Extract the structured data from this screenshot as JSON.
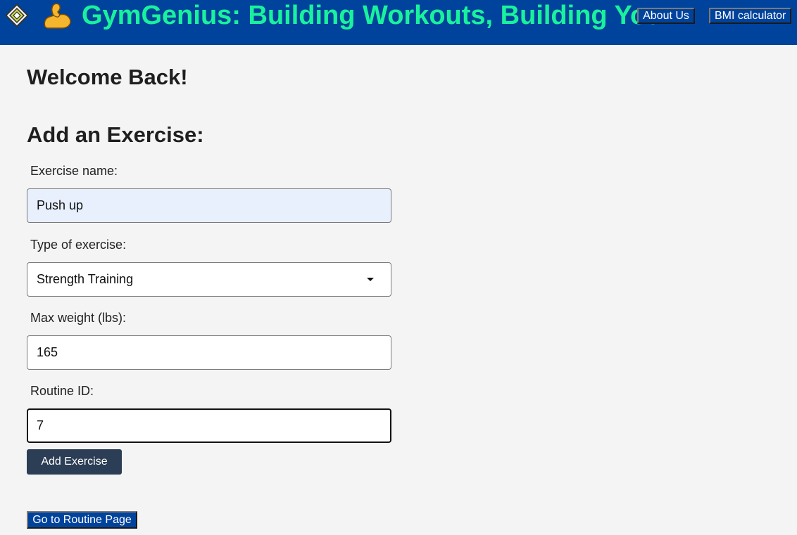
{
  "header": {
    "logo_icon": "gymgenius-logo-icon",
    "muscle_icon": "flexed-biceps-icon",
    "title": "GymGenius: Building Workouts, Building You",
    "nav": {
      "about_label": "About Us",
      "bmi_label": "BMI calculator"
    },
    "colors": {
      "background": "#00439c",
      "title": "#19f29c"
    }
  },
  "main": {
    "welcome": "Welcome Back!",
    "form_title": "Add an Exercise:",
    "fields": {
      "exercise_name": {
        "label": "Exercise name:",
        "value": "Push up"
      },
      "exercise_type": {
        "label": "Type of exercise:",
        "value": "Strength Training"
      },
      "max_weight": {
        "label": "Max weight (lbs):",
        "value": "165"
      },
      "routine_id": {
        "label": "Routine ID:",
        "value": "7"
      }
    },
    "submit_label": "Add Exercise",
    "routine_page_label": "Go to Routine Page"
  }
}
